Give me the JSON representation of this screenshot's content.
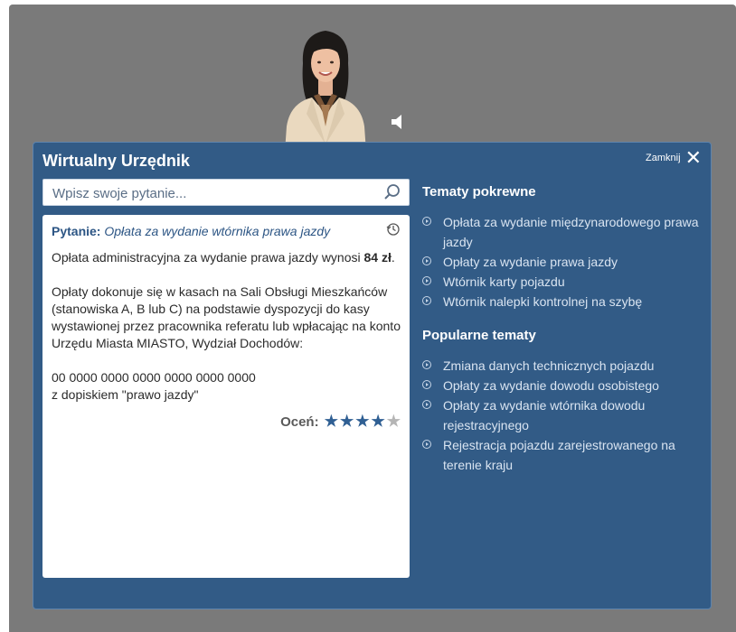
{
  "widget": {
    "title": "Wirtualny Urzędnik",
    "close_label": "Zamknij"
  },
  "search": {
    "placeholder": "Wpisz swoje pytanie..."
  },
  "answer": {
    "question_label": "Pytanie:",
    "question_text": "Opłata za wydanie wtórnika prawa jazdy",
    "paragraph1_text": "Opłata administracyjna za wydanie prawa jazdy wynosi ",
    "paragraph1_amount": "84 zł",
    "paragraph1_end": ".",
    "paragraph2": "Opłaty dokonuje się w kasach na Sali Obsługi Mieszkańców (stanowiska A, B lub C) na podstawie dyspozycji do kasy wystawionej przez pracownika referatu lub wpłacając na konto Urzędu Miasta MIASTO, Wydział Dochodów:",
    "account_number": "00 0000 0000 0000 0000 0000 0000",
    "account_note": "z dopiskiem \"prawo jazdy\"",
    "rate_label": "Oceń:",
    "rating": 4,
    "rating_max": 5
  },
  "related": {
    "title": "Tematy pokrewne",
    "items": [
      "Opłata za wydanie międzynarodowego prawa jazdy",
      "Opłaty za wydanie prawa jazdy",
      "Wtórnik karty pojazdu",
      "Wtórnik nalepki kontrolnej na szybę"
    ]
  },
  "popular": {
    "title": "Popularne tematy",
    "items": [
      "Zmiana danych technicznych pojazdu",
      "Opłaty za wydanie dowodu osobistego",
      "Opłaty za wydanie wtórnika dowodu rejestracyjnego",
      "Rejestracja pojazdu zarejestrowanego na terenie kraju"
    ]
  },
  "colors": {
    "backdrop": "#7a7a7a",
    "panel": "#325b86",
    "accent_text": "#2c5584",
    "star_on": "#2f5f93",
    "star_off": "#b5b5b5"
  },
  "icons": {
    "search": "search-icon",
    "close": "close-icon",
    "speaker": "speaker-icon",
    "history": "history-icon",
    "bullet": "circle-arrow-icon",
    "star": "star-icon"
  }
}
